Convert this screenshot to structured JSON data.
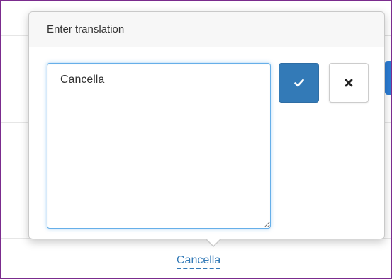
{
  "popover": {
    "title": "Enter translation",
    "textarea_value": "Cancella",
    "submit_icon": "check-icon",
    "cancel_icon": "close-icon"
  },
  "editable_link": {
    "label": "Cancella"
  },
  "colors": {
    "primary": "#337ab7",
    "focus_border": "#66afe9",
    "frame_border": "#7b2c8e"
  }
}
